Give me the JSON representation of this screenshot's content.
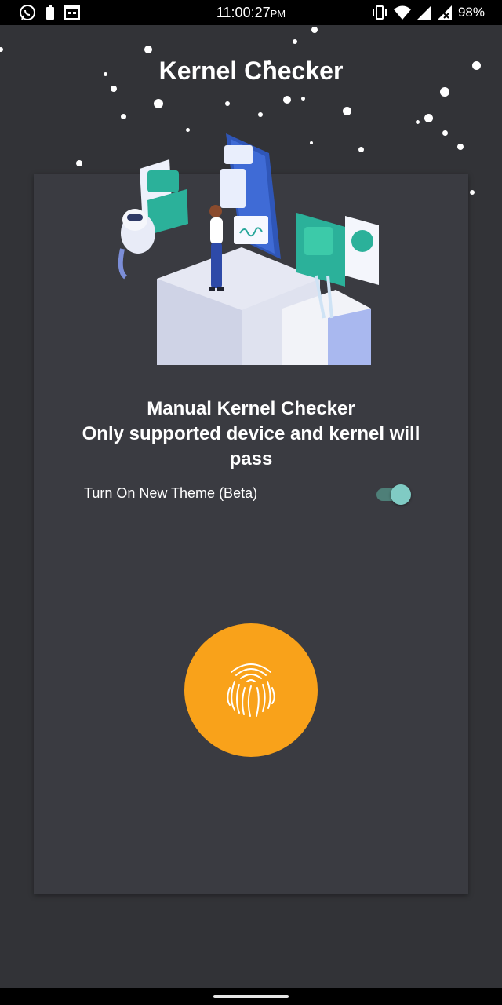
{
  "status_bar": {
    "time": "11:00:27",
    "ampm": "PM",
    "battery": "98%",
    "left_icons": [
      "whatsapp-icon",
      "battery-saver-icon",
      "calendar-icon"
    ],
    "right_icons": [
      "vibrate-icon",
      "wifi-icon",
      "signal-icon",
      "signal-x-icon",
      "battery-icon"
    ]
  },
  "app": {
    "title": "Kernel Checker"
  },
  "card": {
    "headline_line1": "Manual Kernel Checker",
    "headline_line2": "Only supported device and kernel will",
    "headline_line3": "pass",
    "theme_toggle": {
      "label": "Turn On New Theme (Beta)",
      "on": true
    },
    "fingerprint_button_icon": "fingerprint-icon"
  },
  "colors": {
    "background": "#323337",
    "card": "#3a3b41",
    "accent_orange": "#f9a21a",
    "toggle_thumb": "#80cbc4",
    "toggle_track": "#4e7f78"
  }
}
